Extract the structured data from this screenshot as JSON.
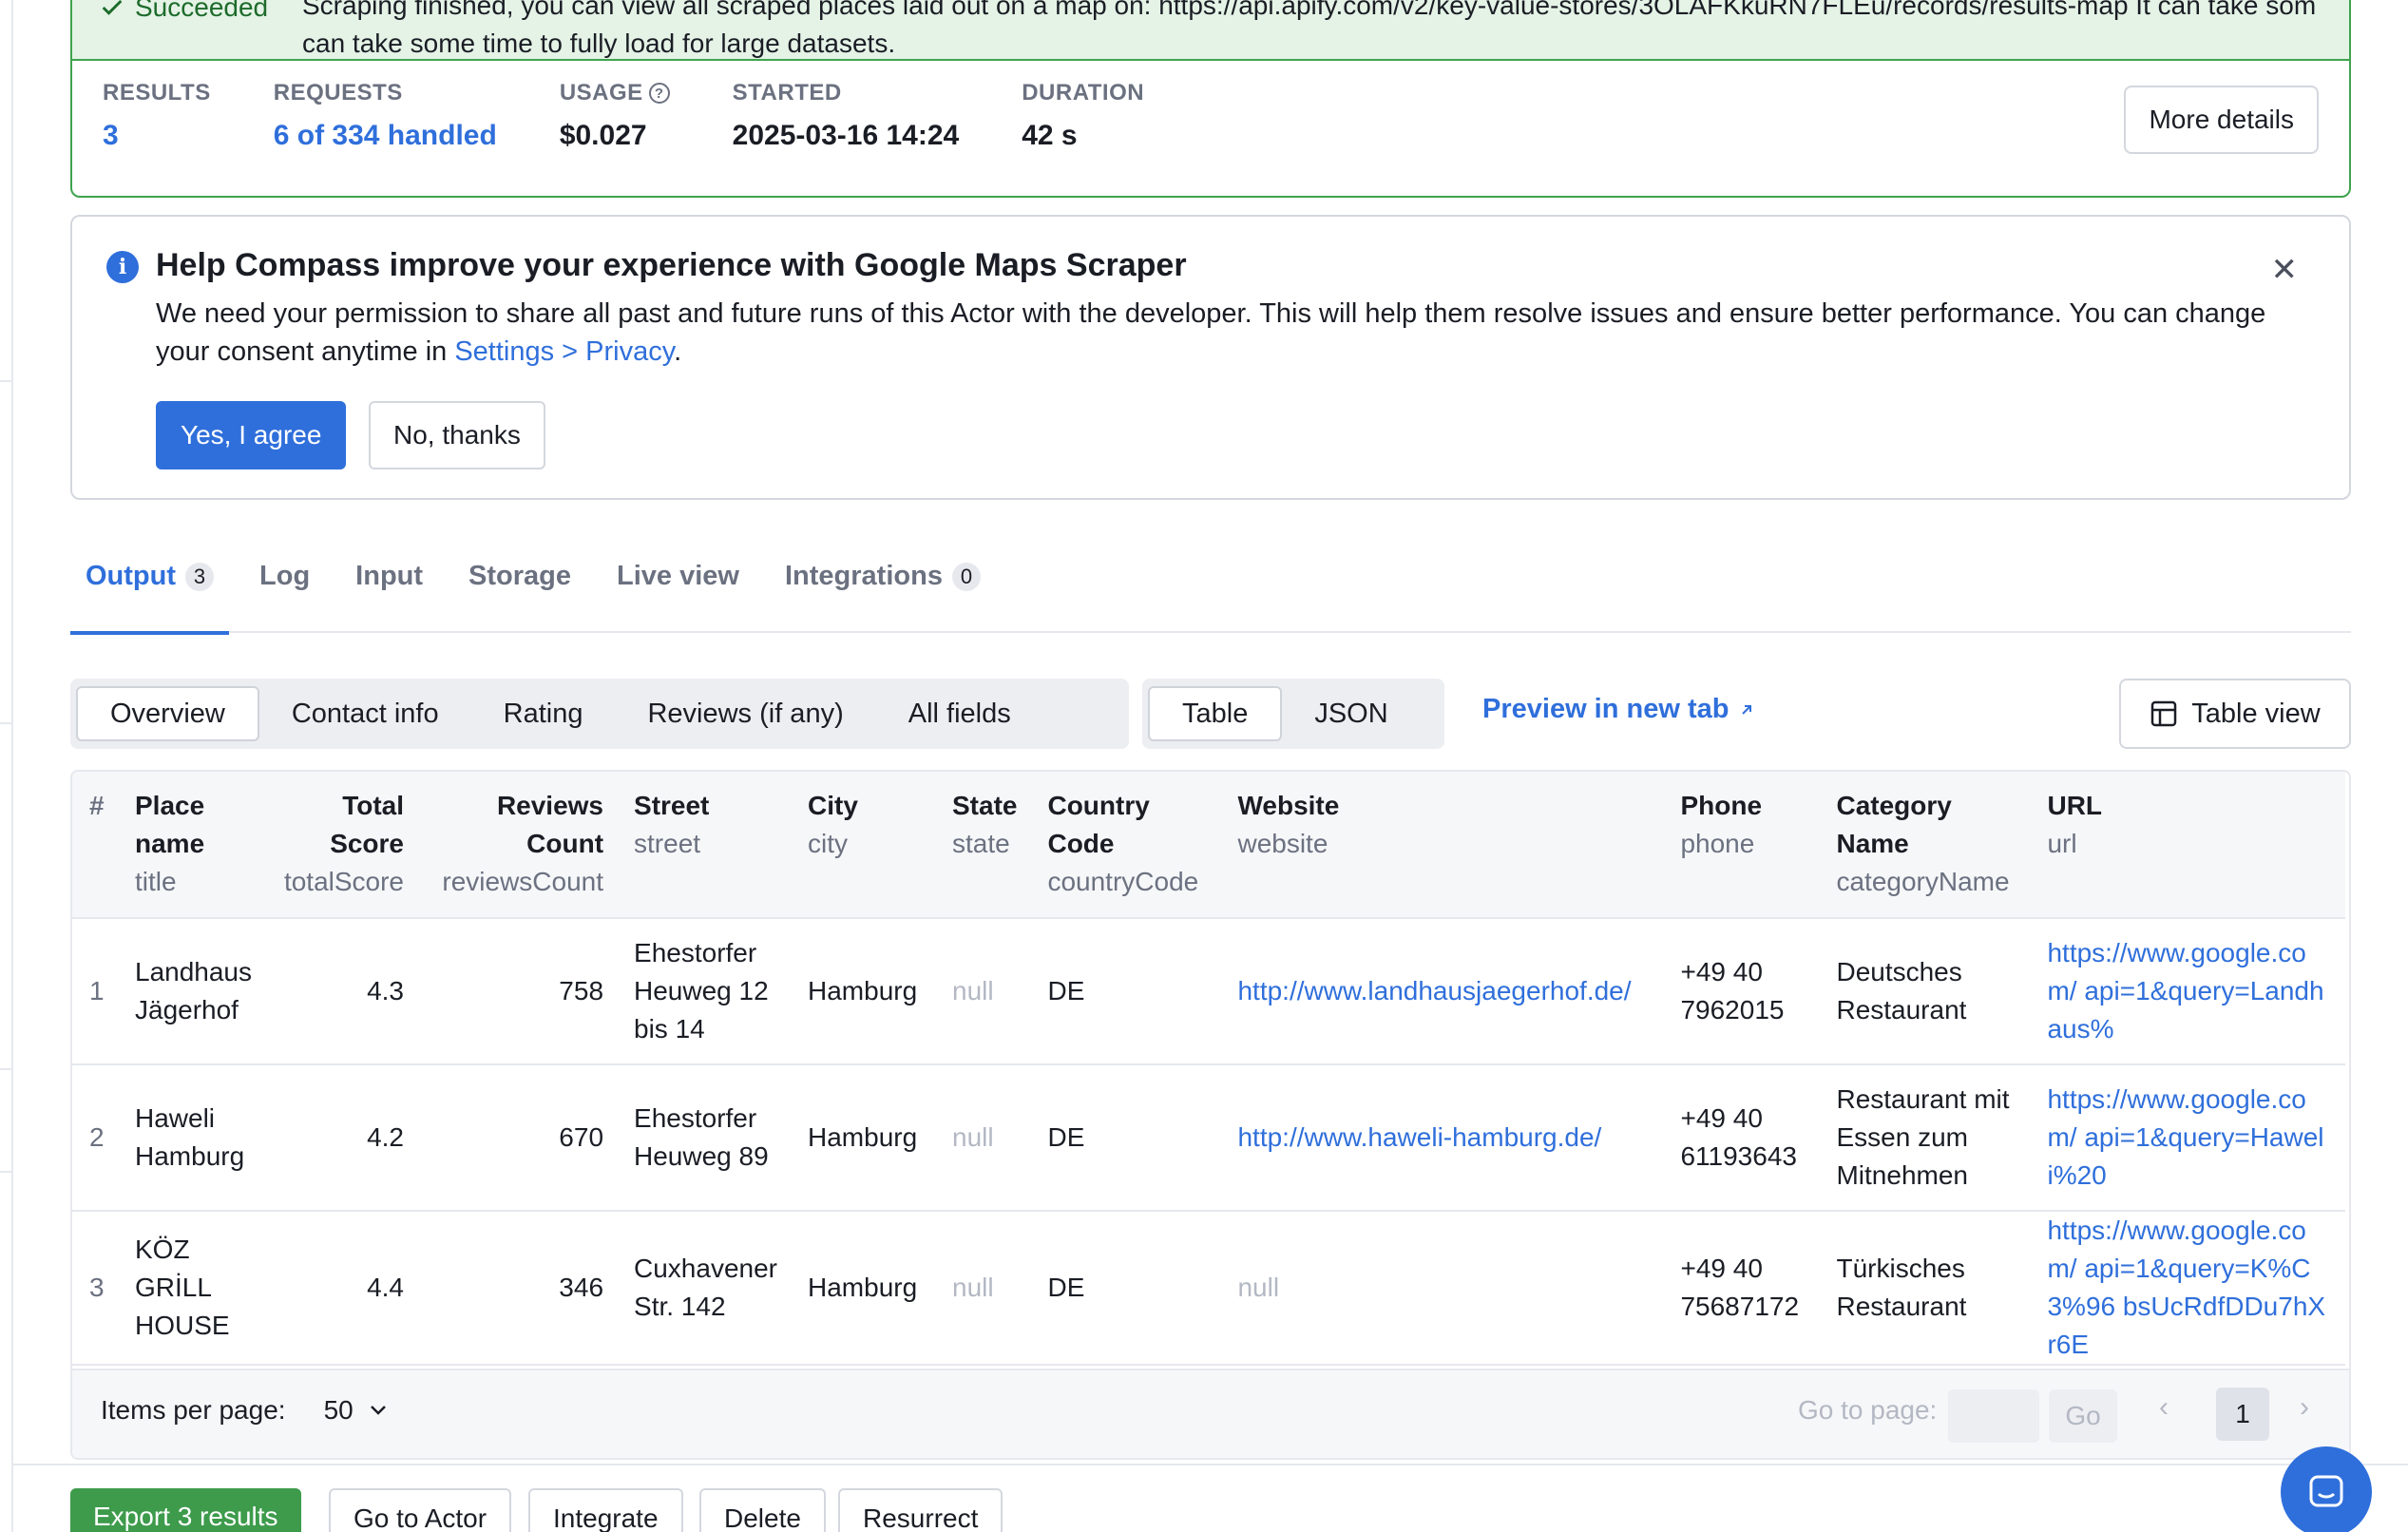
{
  "status": {
    "badge": "Succeeded",
    "message": "Scraping finished, you can view all scraped places laid out on a map on: https://api.apify.com/v2/key-value-stores/3OLAFKkuRN7FLEu/records/results-map It can take some time to fully load for large datasets.",
    "message_visible_line2": "can take some time to fully load for large datasets.",
    "stats": [
      {
        "label": "RESULTS",
        "value": "3"
      },
      {
        "label": "REQUESTS",
        "value": "6 of 334 handled"
      },
      {
        "label": "USAGE",
        "value": "$0.027"
      },
      {
        "label": "STARTED",
        "value": "2025-03-16 14:24"
      },
      {
        "label": "DURATION",
        "value": "42 s"
      }
    ],
    "more_details": "More details"
  },
  "consent": {
    "title": "Help Compass improve your experience with Google Maps Scraper",
    "body_before": "We need your permission to share all past and future runs of this Actor with the developer. This will help them resolve issues and ensure better performance. You can change your consent anytime in ",
    "body_link": "Settings > Privacy",
    "body_after": ".",
    "agree": "Yes, I agree",
    "decline": "No, thanks"
  },
  "tabs": [
    {
      "label": "Output",
      "count": "3"
    },
    {
      "label": "Log"
    },
    {
      "label": "Input"
    },
    {
      "label": "Storage"
    },
    {
      "label": "Live view"
    },
    {
      "label": "Integrations",
      "count": "0"
    }
  ],
  "views": [
    "Overview",
    "Contact info",
    "Rating",
    "Reviews (if any)",
    "All fields"
  ],
  "formats": [
    "Table",
    "JSON"
  ],
  "preview_link": "Preview in new tab",
  "table_view": "Table view",
  "table": {
    "columns": [
      {
        "title": "#",
        "key": ""
      },
      {
        "title": "Place name",
        "key": "title"
      },
      {
        "title": "Total Score",
        "key": "totalScore"
      },
      {
        "title": "Reviews Count",
        "key": "reviewsCount"
      },
      {
        "title": "Street",
        "key": "street"
      },
      {
        "title": "City",
        "key": "city"
      },
      {
        "title": "State",
        "key": "state"
      },
      {
        "title": "Country Code",
        "key": "countryCode"
      },
      {
        "title": "Website",
        "key": "website"
      },
      {
        "title": "Phone",
        "key": "phone"
      },
      {
        "title": "Category Name",
        "key": "categoryName"
      },
      {
        "title": "URL",
        "key": "url"
      }
    ],
    "rows": [
      {
        "idx": "1",
        "title": "Landhaus Jägerhof",
        "totalScore": "4.3",
        "reviewsCount": "758",
        "street": "Ehestorfer Heuweg 12 bis 14",
        "city": "Hamburg",
        "state": "null",
        "countryCode": "DE",
        "website": "http://www.landhausjaegerhof.de/",
        "phone": "+49 40 7962015",
        "categoryName": "Deutsches Restaurant",
        "url": "https://www.google.com/ api=1&query=Landhaus%"
      },
      {
        "idx": "2",
        "title": "Haweli Hamburg",
        "totalScore": "4.2",
        "reviewsCount": "670",
        "street": "Ehestorfer Heuweg 89",
        "city": "Hamburg",
        "state": "null",
        "countryCode": "DE",
        "website": "http://www.haweli-hamburg.de/",
        "phone": "+49 40 61193643",
        "categoryName": "Restaurant mit Essen zum Mitnehmen",
        "url": "https://www.google.com/ api=1&query=Haweli%20"
      },
      {
        "idx": "3",
        "title": "KÖZ GRİLL HOUSE",
        "totalScore": "4.4",
        "reviewsCount": "346",
        "street": "Cuxhavener Str. 142",
        "city": "Hamburg",
        "state": "null",
        "countryCode": "DE",
        "website": "null",
        "phone": "+49 40 75687172",
        "categoryName": "Türkisches Restaurant",
        "url": "https://www.google.com/ api=1&query=K%C3%96 bsUcRdfDDu7hXr6E"
      }
    ]
  },
  "pagination": {
    "items_label": "Items per page:",
    "items_value": "50",
    "goto_label": "Go to page:",
    "go": "Go",
    "page": "1"
  },
  "actions": [
    "Export 3 results",
    "Go to Actor",
    "Integrate",
    "Delete",
    "Resurrect"
  ],
  "colors": {
    "accent": "#2f6fdb",
    "success": "#3fa34d",
    "success_bg": "#e4f3e6"
  }
}
